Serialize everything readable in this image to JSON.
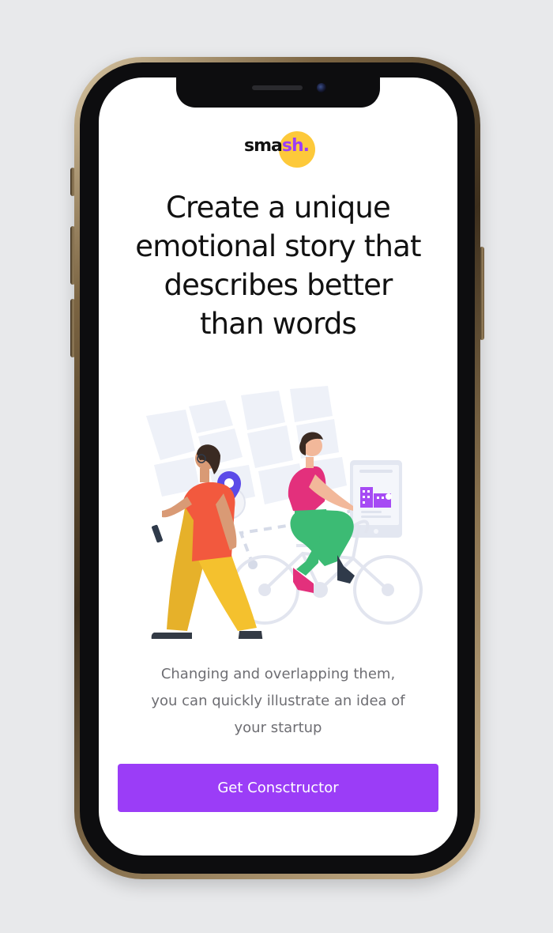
{
  "logo": {
    "text_prefix": "sma",
    "text_accent": "sh.",
    "accent_color": "#9b3df7",
    "circle_color": "#fdc93a"
  },
  "headline": {
    "line1": "Create a unique",
    "line2": "emotional story that",
    "line3": "describes better",
    "line4": "than words"
  },
  "description": {
    "line1": "Changing and overlapping them,",
    "line2": "you can quickly illustrate an idea of",
    "line3": "your startup"
  },
  "cta": {
    "label": "Get Consctructor",
    "color": "#9b3df7"
  },
  "illustration": {
    "map_pin_color": "#5b4ae8",
    "accent_purple": "#a64bf4",
    "woman_walking_top_color": "#f2593e",
    "woman_walking_pants_color": "#f4c12e",
    "cyclist_top_color": "#e3307c",
    "cyclist_pants_color": "#3cbb74"
  }
}
